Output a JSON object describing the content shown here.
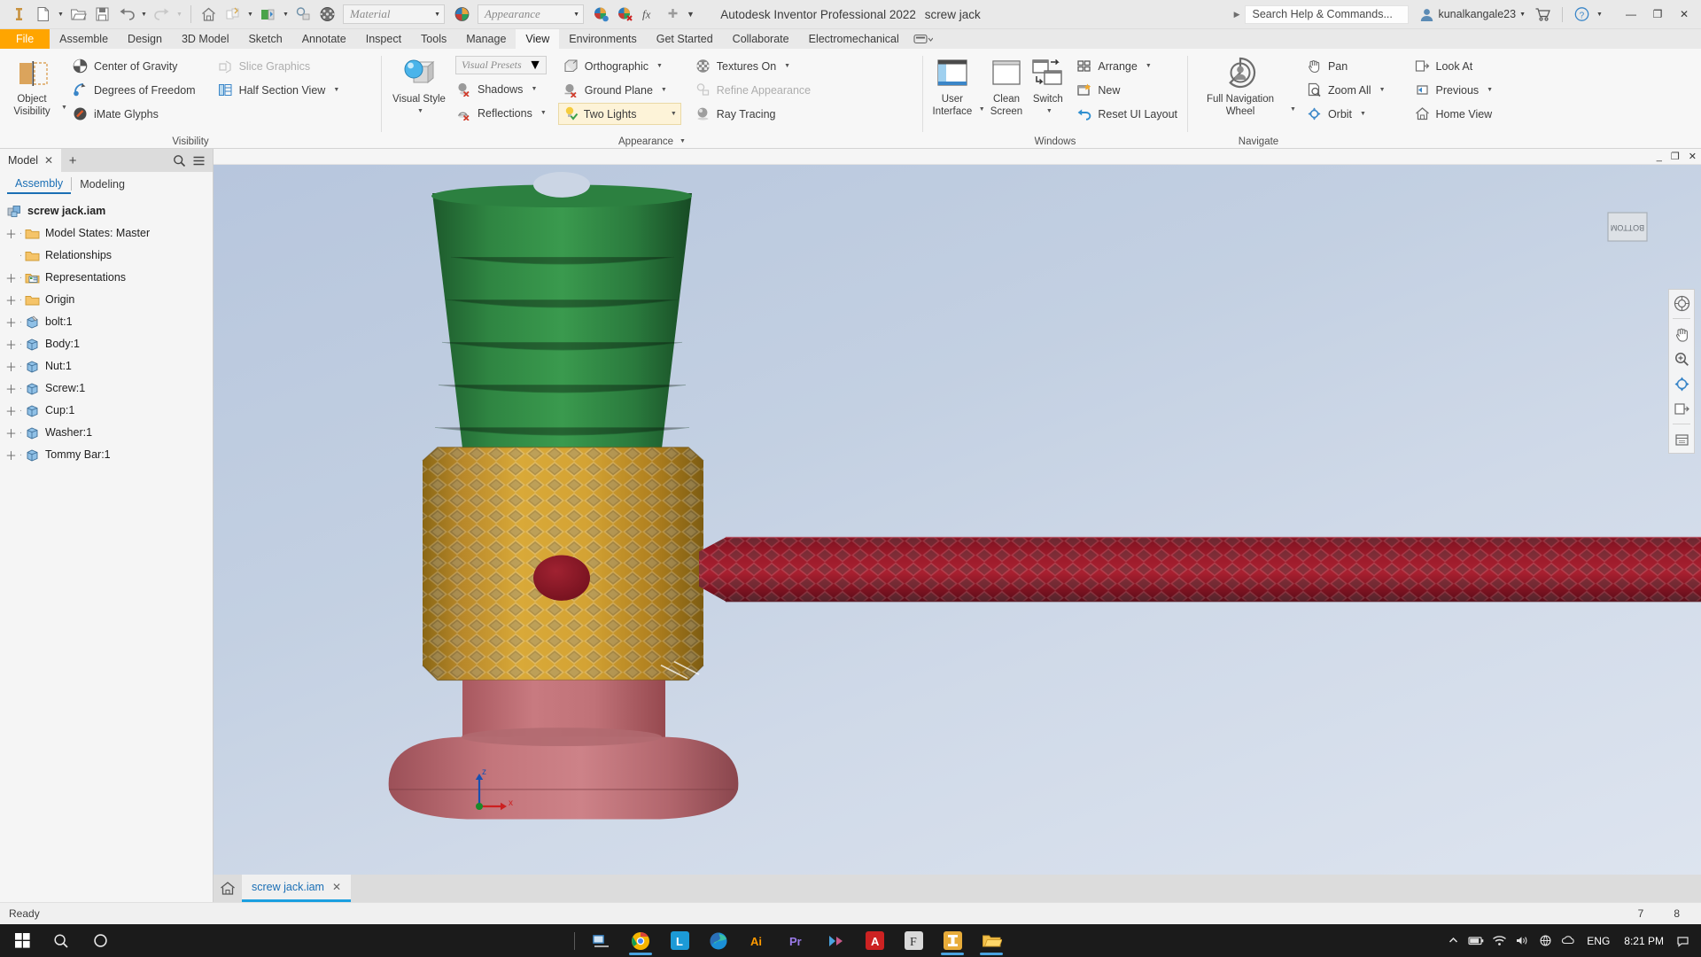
{
  "titlebar": {
    "app_title": "Autodesk Inventor Professional 2022",
    "document_title": "screw jack",
    "material_combo": "Material",
    "appearance_combo": "Appearance",
    "search_placeholder": "Search Help & Commands...",
    "user_name": "kunalkangale23",
    "qat": [
      {
        "name": "inventor-logo-icon",
        "label": "Inventor"
      },
      {
        "name": "new-file-icon",
        "label": "New"
      },
      {
        "name": "open-folder-icon",
        "label": "Open"
      },
      {
        "name": "save-icon",
        "label": "Save"
      },
      {
        "name": "undo-icon",
        "label": "Undo"
      },
      {
        "name": "redo-icon",
        "label": "Redo"
      },
      {
        "name": "home-icon",
        "label": "Home"
      },
      {
        "name": "return-icon",
        "label": "Return"
      },
      {
        "name": "update-icon",
        "label": "Update"
      },
      {
        "name": "select-icon",
        "label": "Select"
      },
      {
        "name": "material-sphere-icon",
        "label": "Materials"
      }
    ],
    "window_buttons": {
      "minimize": "—",
      "restore": "❐",
      "close": "✕"
    }
  },
  "ribbon_tabs": [
    {
      "label": "File",
      "active": false,
      "file": true
    },
    {
      "label": "Assemble",
      "active": false
    },
    {
      "label": "Design",
      "active": false
    },
    {
      "label": "3D Model",
      "active": false
    },
    {
      "label": "Sketch",
      "active": false
    },
    {
      "label": "Annotate",
      "active": false
    },
    {
      "label": "Inspect",
      "active": false
    },
    {
      "label": "Tools",
      "active": false
    },
    {
      "label": "Manage",
      "active": false
    },
    {
      "label": "View",
      "active": true
    },
    {
      "label": "Environments",
      "active": false
    },
    {
      "label": "Get Started",
      "active": false
    },
    {
      "label": "Collaborate",
      "active": false
    },
    {
      "label": "Electromechanical",
      "active": false
    }
  ],
  "ribbon": {
    "groups": [
      {
        "title": "Visibility",
        "big_button": {
          "label_line1": "Object",
          "label_line2": "Visibility",
          "icon": "object-visibility-icon"
        },
        "col1": [
          {
            "label": "Center of Gravity",
            "icon": "center-of-gravity-icon",
            "disabled": false,
            "dropdown": false
          },
          {
            "label": "Degrees of Freedom",
            "icon": "degrees-of-freedom-icon",
            "disabled": false,
            "dropdown": false
          },
          {
            "label": "iMate Glyphs",
            "icon": "imate-glyphs-icon",
            "disabled": false,
            "dropdown": false
          }
        ],
        "col2": [
          {
            "label": "Slice Graphics",
            "icon": "slice-graphics-icon",
            "disabled": true,
            "dropdown": false
          },
          {
            "label": "Half Section View",
            "icon": "half-section-view-icon",
            "disabled": false,
            "dropdown": true
          }
        ]
      },
      {
        "title": "Appearance",
        "title_dropdown": true,
        "big_button": {
          "label_line1": "Visual Style",
          "label_line2": "",
          "icon": "visual-style-icon",
          "dropdown": true
        },
        "presets_combo": "Visual Presets",
        "col1": [
          {
            "label": "Shadows",
            "icon": "shadows-off-icon",
            "disabled": false,
            "dropdown": true
          },
          {
            "label": "Reflections",
            "icon": "reflections-off-icon",
            "disabled": false,
            "dropdown": true
          }
        ],
        "col2": [
          {
            "label": "Orthographic",
            "icon": "orthographic-icon",
            "disabled": false,
            "dropdown": true
          },
          {
            "label": "Ground Plane",
            "icon": "ground-plane-off-icon",
            "disabled": false,
            "dropdown": true
          },
          {
            "label": "Two Lights",
            "icon": "two-lights-icon",
            "disabled": false,
            "dropdown": true,
            "highlight": true
          }
        ],
        "col3": [
          {
            "label": "Textures On",
            "icon": "textures-on-icon",
            "disabled": false,
            "dropdown": true
          },
          {
            "label": "Refine Appearance",
            "icon": "refine-appearance-icon",
            "disabled": true,
            "dropdown": false
          },
          {
            "label": "Ray Tracing",
            "icon": "ray-tracing-icon",
            "disabled": false,
            "dropdown": false
          }
        ]
      },
      {
        "title": "Windows",
        "big_buttons": [
          {
            "label_line1": "User",
            "label_line2": "Interface",
            "icon": "user-interface-icon",
            "dropdown": true
          },
          {
            "label_line1": "Clean",
            "label_line2": "Screen",
            "icon": "clean-screen-icon",
            "dropdown": false
          },
          {
            "label_line1": "Switch",
            "label_line2": "",
            "icon": "switch-windows-icon",
            "dropdown": true
          }
        ],
        "col1": [
          {
            "label": "Arrange",
            "icon": "arrange-icon",
            "disabled": false,
            "dropdown": true
          },
          {
            "label": "New",
            "icon": "new-window-icon",
            "disabled": false,
            "dropdown": false
          },
          {
            "label": "Reset UI Layout",
            "icon": "reset-ui-layout-icon",
            "disabled": false,
            "dropdown": false
          }
        ]
      },
      {
        "title": "Navigate",
        "big_button": {
          "label_line1": "Full Navigation",
          "label_line2": "Wheel",
          "icon": "full-navigation-wheel-icon",
          "dropdown": true
        },
        "col1": [
          {
            "label": "Pan",
            "icon": "pan-icon",
            "disabled": false,
            "dropdown": false
          },
          {
            "label": "Zoom All",
            "icon": "zoom-all-icon",
            "disabled": false,
            "dropdown": true
          },
          {
            "label": "Orbit",
            "icon": "orbit-icon",
            "disabled": false,
            "dropdown": true
          }
        ],
        "col2": [
          {
            "label": "Look At",
            "icon": "look-at-icon",
            "disabled": false,
            "dropdown": false
          },
          {
            "label": "Previous",
            "icon": "previous-view-icon",
            "disabled": false,
            "dropdown": true
          },
          {
            "label": "Home View",
            "icon": "home-view-icon",
            "disabled": false,
            "dropdown": false
          }
        ]
      }
    ]
  },
  "browser": {
    "panel_tab": "Model",
    "subtabs": [
      {
        "label": "Assembly",
        "active": true
      },
      {
        "label": "Modeling",
        "active": false
      }
    ],
    "tree": [
      {
        "label": "screw jack.iam",
        "icon": "assembly-icon",
        "expandable": false,
        "root": true,
        "indent": 0
      },
      {
        "label": "Model States: Master",
        "icon": "folder-icon",
        "expandable": true,
        "indent": 1
      },
      {
        "label": "Relationships",
        "icon": "folder-icon",
        "expandable": false,
        "indent": 1
      },
      {
        "label": "Representations",
        "icon": "representations-icon",
        "expandable": true,
        "indent": 1
      },
      {
        "label": "Origin",
        "icon": "folder-icon",
        "expandable": true,
        "indent": 1
      },
      {
        "label": "bolt:1",
        "icon": "part-pin-icon",
        "expandable": true,
        "indent": 1
      },
      {
        "label": "Body:1",
        "icon": "part-icon",
        "expandable": true,
        "indent": 1
      },
      {
        "label": "Nut:1",
        "icon": "part-icon",
        "expandable": true,
        "indent": 1
      },
      {
        "label": "Screw:1",
        "icon": "part-icon",
        "expandable": true,
        "indent": 1
      },
      {
        "label": "Cup:1",
        "icon": "part-icon",
        "expandable": true,
        "indent": 1
      },
      {
        "label": "Washer:1",
        "icon": "part-icon",
        "expandable": true,
        "indent": 1
      },
      {
        "label": "Tommy Bar:1",
        "icon": "part-icon",
        "expandable": true,
        "indent": 1
      }
    ]
  },
  "viewport": {
    "viewcube_label": "BOTTOM",
    "axis_z": "z",
    "axis_x": "x",
    "nav_icons": [
      {
        "name": "full-navigation-wheel-nav-icon"
      },
      {
        "name": "pan-nav-icon"
      },
      {
        "name": "zoom-nav-icon"
      },
      {
        "name": "orbit-nav-icon"
      },
      {
        "name": "look-at-nav-icon"
      }
    ]
  },
  "doctabs": {
    "home_icon": "home-tab-icon",
    "tabs": [
      {
        "label": "screw jack.iam",
        "active": true,
        "close": "✕"
      }
    ]
  },
  "statusbar": {
    "message": "Ready",
    "value_left": "7",
    "value_right": "8"
  },
  "taskbar": {
    "start_icon": "windows-start-icon",
    "search_icon": "taskbar-search-icon",
    "cortana_icon": "taskbar-cortana-icon",
    "apps": [
      {
        "name": "taskview-icon",
        "label": "Task View"
      },
      {
        "name": "chrome-icon",
        "label": "Google Chrome",
        "active": true
      },
      {
        "name": "lightroom-icon",
        "label": "Lightroom"
      },
      {
        "name": "edge-icon",
        "label": "Microsoft Edge"
      },
      {
        "name": "illustrator-icon",
        "label": "Ai"
      },
      {
        "name": "premiere-icon",
        "label": "Pr"
      },
      {
        "name": "media-icon",
        "label": "Media"
      },
      {
        "name": "acrobat-icon",
        "label": "A"
      },
      {
        "name": "font-icon",
        "label": "F"
      },
      {
        "name": "inventor-taskbar-icon",
        "label": "Inventor",
        "active": true
      },
      {
        "name": "explorer-icon",
        "label": "File Explorer",
        "active": true
      }
    ],
    "tray": [
      {
        "name": "show-hidden-icons-icon"
      },
      {
        "name": "battery-icon"
      },
      {
        "name": "wifi-icon"
      },
      {
        "name": "volume-icon"
      },
      {
        "name": "network-icon"
      },
      {
        "name": "onedrive-icon"
      }
    ],
    "language": "ENG",
    "time": "8:21 PM",
    "notification_icon": "notifications-icon"
  }
}
